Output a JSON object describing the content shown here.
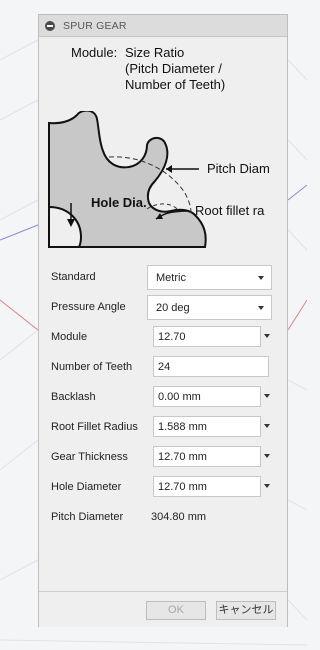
{
  "dialog": {
    "title": "SPUR GEAR"
  },
  "illustration": {
    "caption_prefix": "Module:",
    "caption_text": "Size Ratio\n(Pitch Diameter /\nNumber of Teeth)",
    "labels": {
      "pitch_diameter": "Pitch Diam",
      "root_fillet": "Root fillet ra",
      "hole_dia": "Hole Dia."
    }
  },
  "form": {
    "standard": {
      "label": "Standard",
      "value": "Metric"
    },
    "pressure_angle": {
      "label": "Pressure Angle",
      "value": "20 deg"
    },
    "module": {
      "label": "Module",
      "value": "12.70"
    },
    "number_of_teeth": {
      "label": "Number of Teeth",
      "value": "24"
    },
    "backlash": {
      "label": "Backlash",
      "value": "0.00 mm"
    },
    "root_fillet_radius": {
      "label": "Root Fillet Radius",
      "value": "1.588 mm"
    },
    "gear_thickness": {
      "label": "Gear Thickness",
      "value": "12.70 mm"
    },
    "hole_diameter": {
      "label": "Hole Diameter",
      "value": "12.70 mm"
    },
    "pitch_diameter": {
      "label": "Pitch Diameter",
      "value": "304.80 mm"
    }
  },
  "buttons": {
    "ok": "OK",
    "cancel": "キャンセル"
  }
}
